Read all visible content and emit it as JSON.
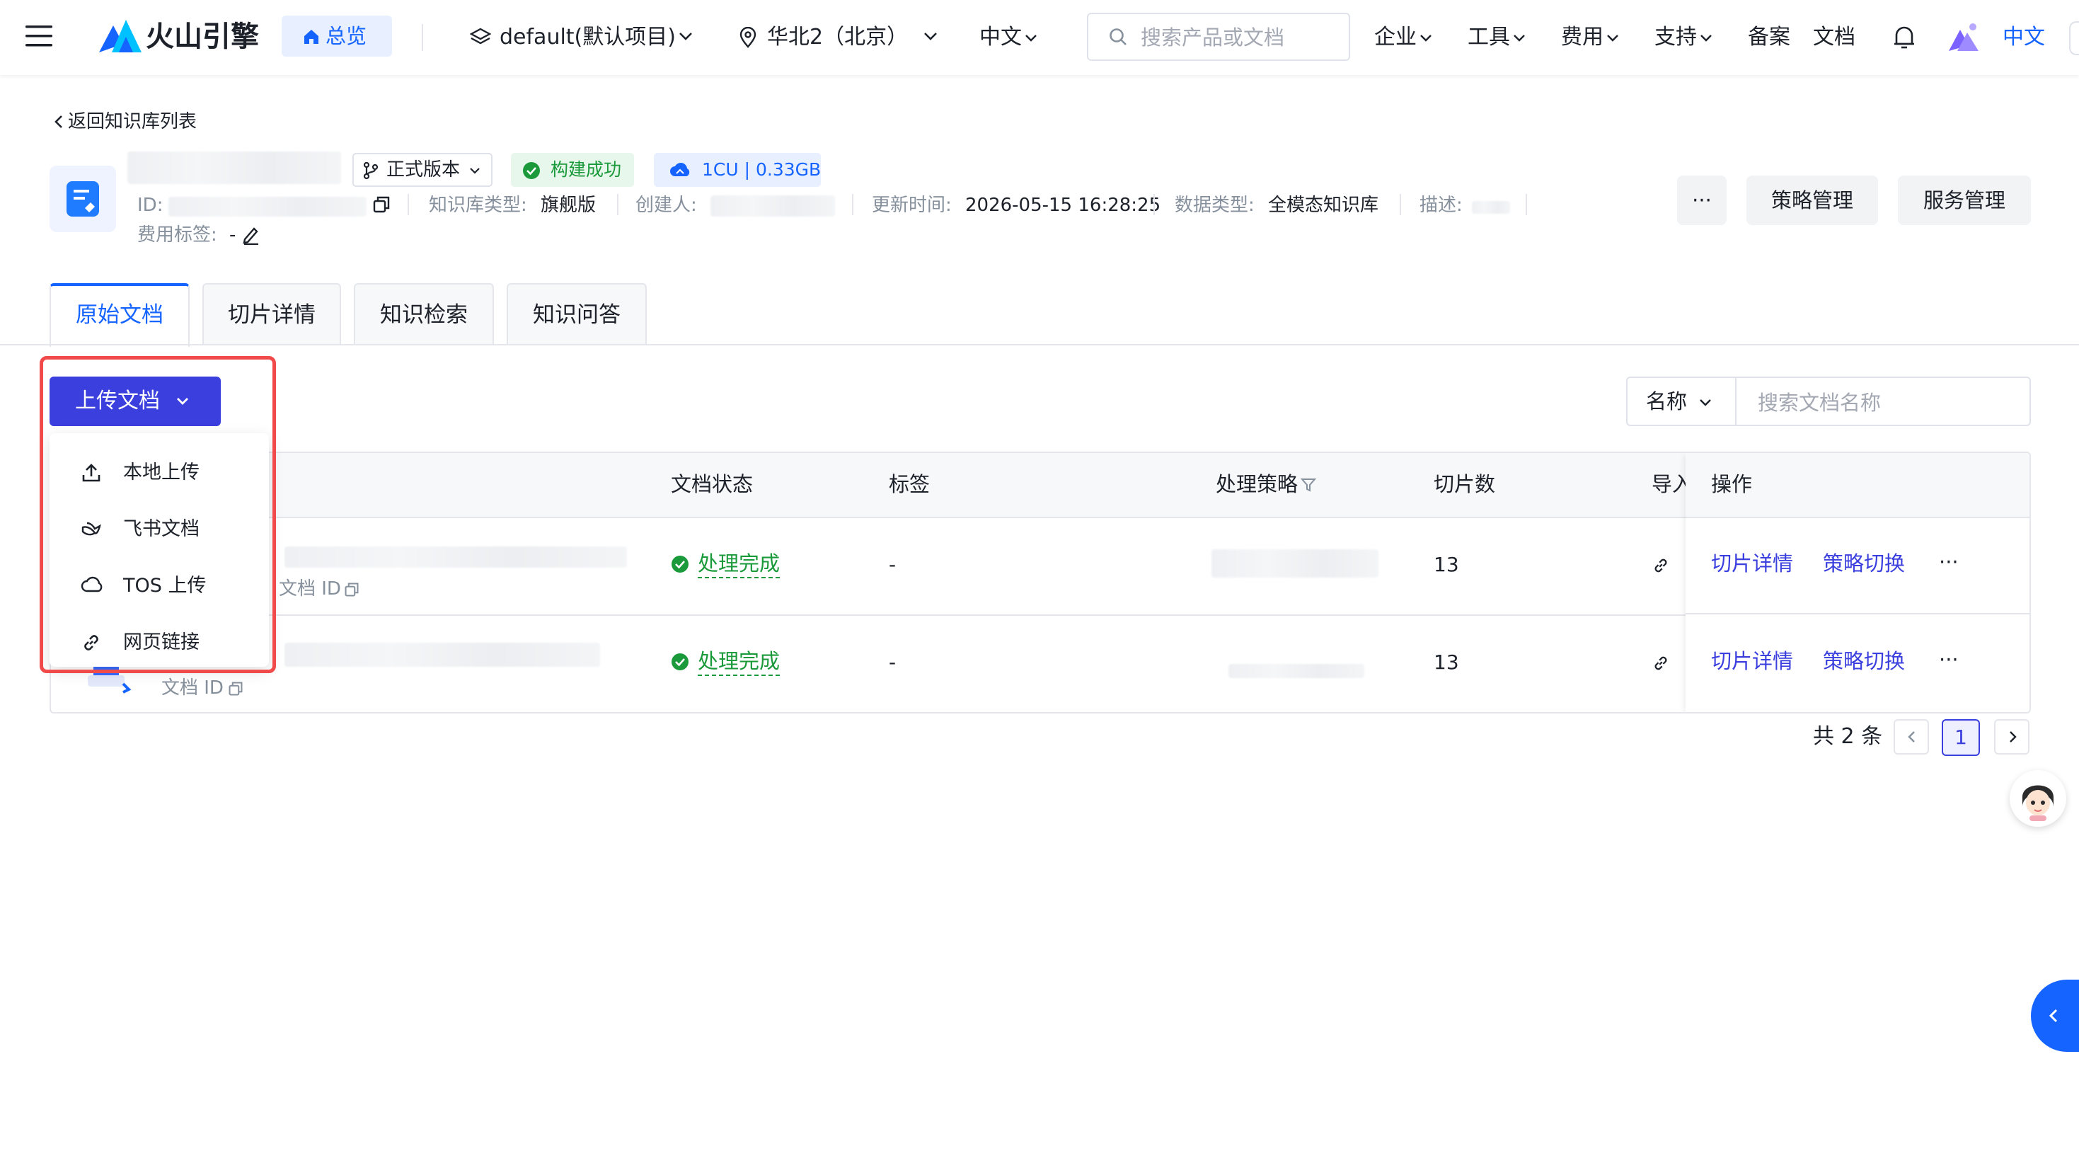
{
  "topnav": {
    "logo_text": "火山引擎",
    "overview": "总览",
    "project": "default(默认项目)",
    "region": "华北2（北京）",
    "language": "中文",
    "search_placeholder": "搜索产品或文档",
    "menu": [
      "企业",
      "工具",
      "费用",
      "支持"
    ],
    "filing": "备案",
    "docs": "文档",
    "lang_right": "中文"
  },
  "header": {
    "back_link": "返回知识库列表",
    "version": "正式版本",
    "build_status": "构建成功",
    "resource": "1CU | 0.33GB",
    "id_label": "ID:",
    "kb_type_label": "知识库类型:",
    "kb_type_value": "旗舰版",
    "creator_label": "创建人:",
    "updated_label": "更新时间:",
    "updated_value": "2026-05-15 16:28:25",
    "data_type_label": "数据类型:",
    "data_type_value": "全模态知识库",
    "desc_label": "描述:",
    "cost_tag_label": "费用标签:",
    "cost_tag_value": "-",
    "more_label": "···",
    "strategy_btn": "策略管理",
    "service_btn": "服务管理"
  },
  "tabs": [
    "原始文档",
    "切片详情",
    "知识检索",
    "知识问答"
  ],
  "upload": {
    "button": "上传文档",
    "menu": [
      "本地上传",
      "飞书文档",
      "TOS 上传",
      "网页链接"
    ]
  },
  "filter": {
    "field": "名称",
    "placeholder": "搜索文档名称"
  },
  "table": {
    "columns": [
      "文档状态",
      "标签",
      "处理策略",
      "切片数",
      "导入",
      "操作"
    ],
    "rows": [
      {
        "doc_id_label": "文档 ID",
        "status": "处理完成",
        "tag": "-",
        "chunks": "13",
        "op1": "切片详情",
        "op2": "策略切换",
        "more": "···"
      },
      {
        "doc_id_label": "文档 ID",
        "status": "处理完成",
        "tag": "-",
        "chunks": "13",
        "op1": "切片详情",
        "op2": "策略切换",
        "more": "···"
      }
    ]
  },
  "pagination": {
    "total": "共 2 条",
    "current": "1"
  },
  "colors": {
    "primary": "#3a3fde",
    "brand_blue": "#1664ff",
    "success": "#1a9a3a",
    "highlight": "#f04a4a"
  }
}
